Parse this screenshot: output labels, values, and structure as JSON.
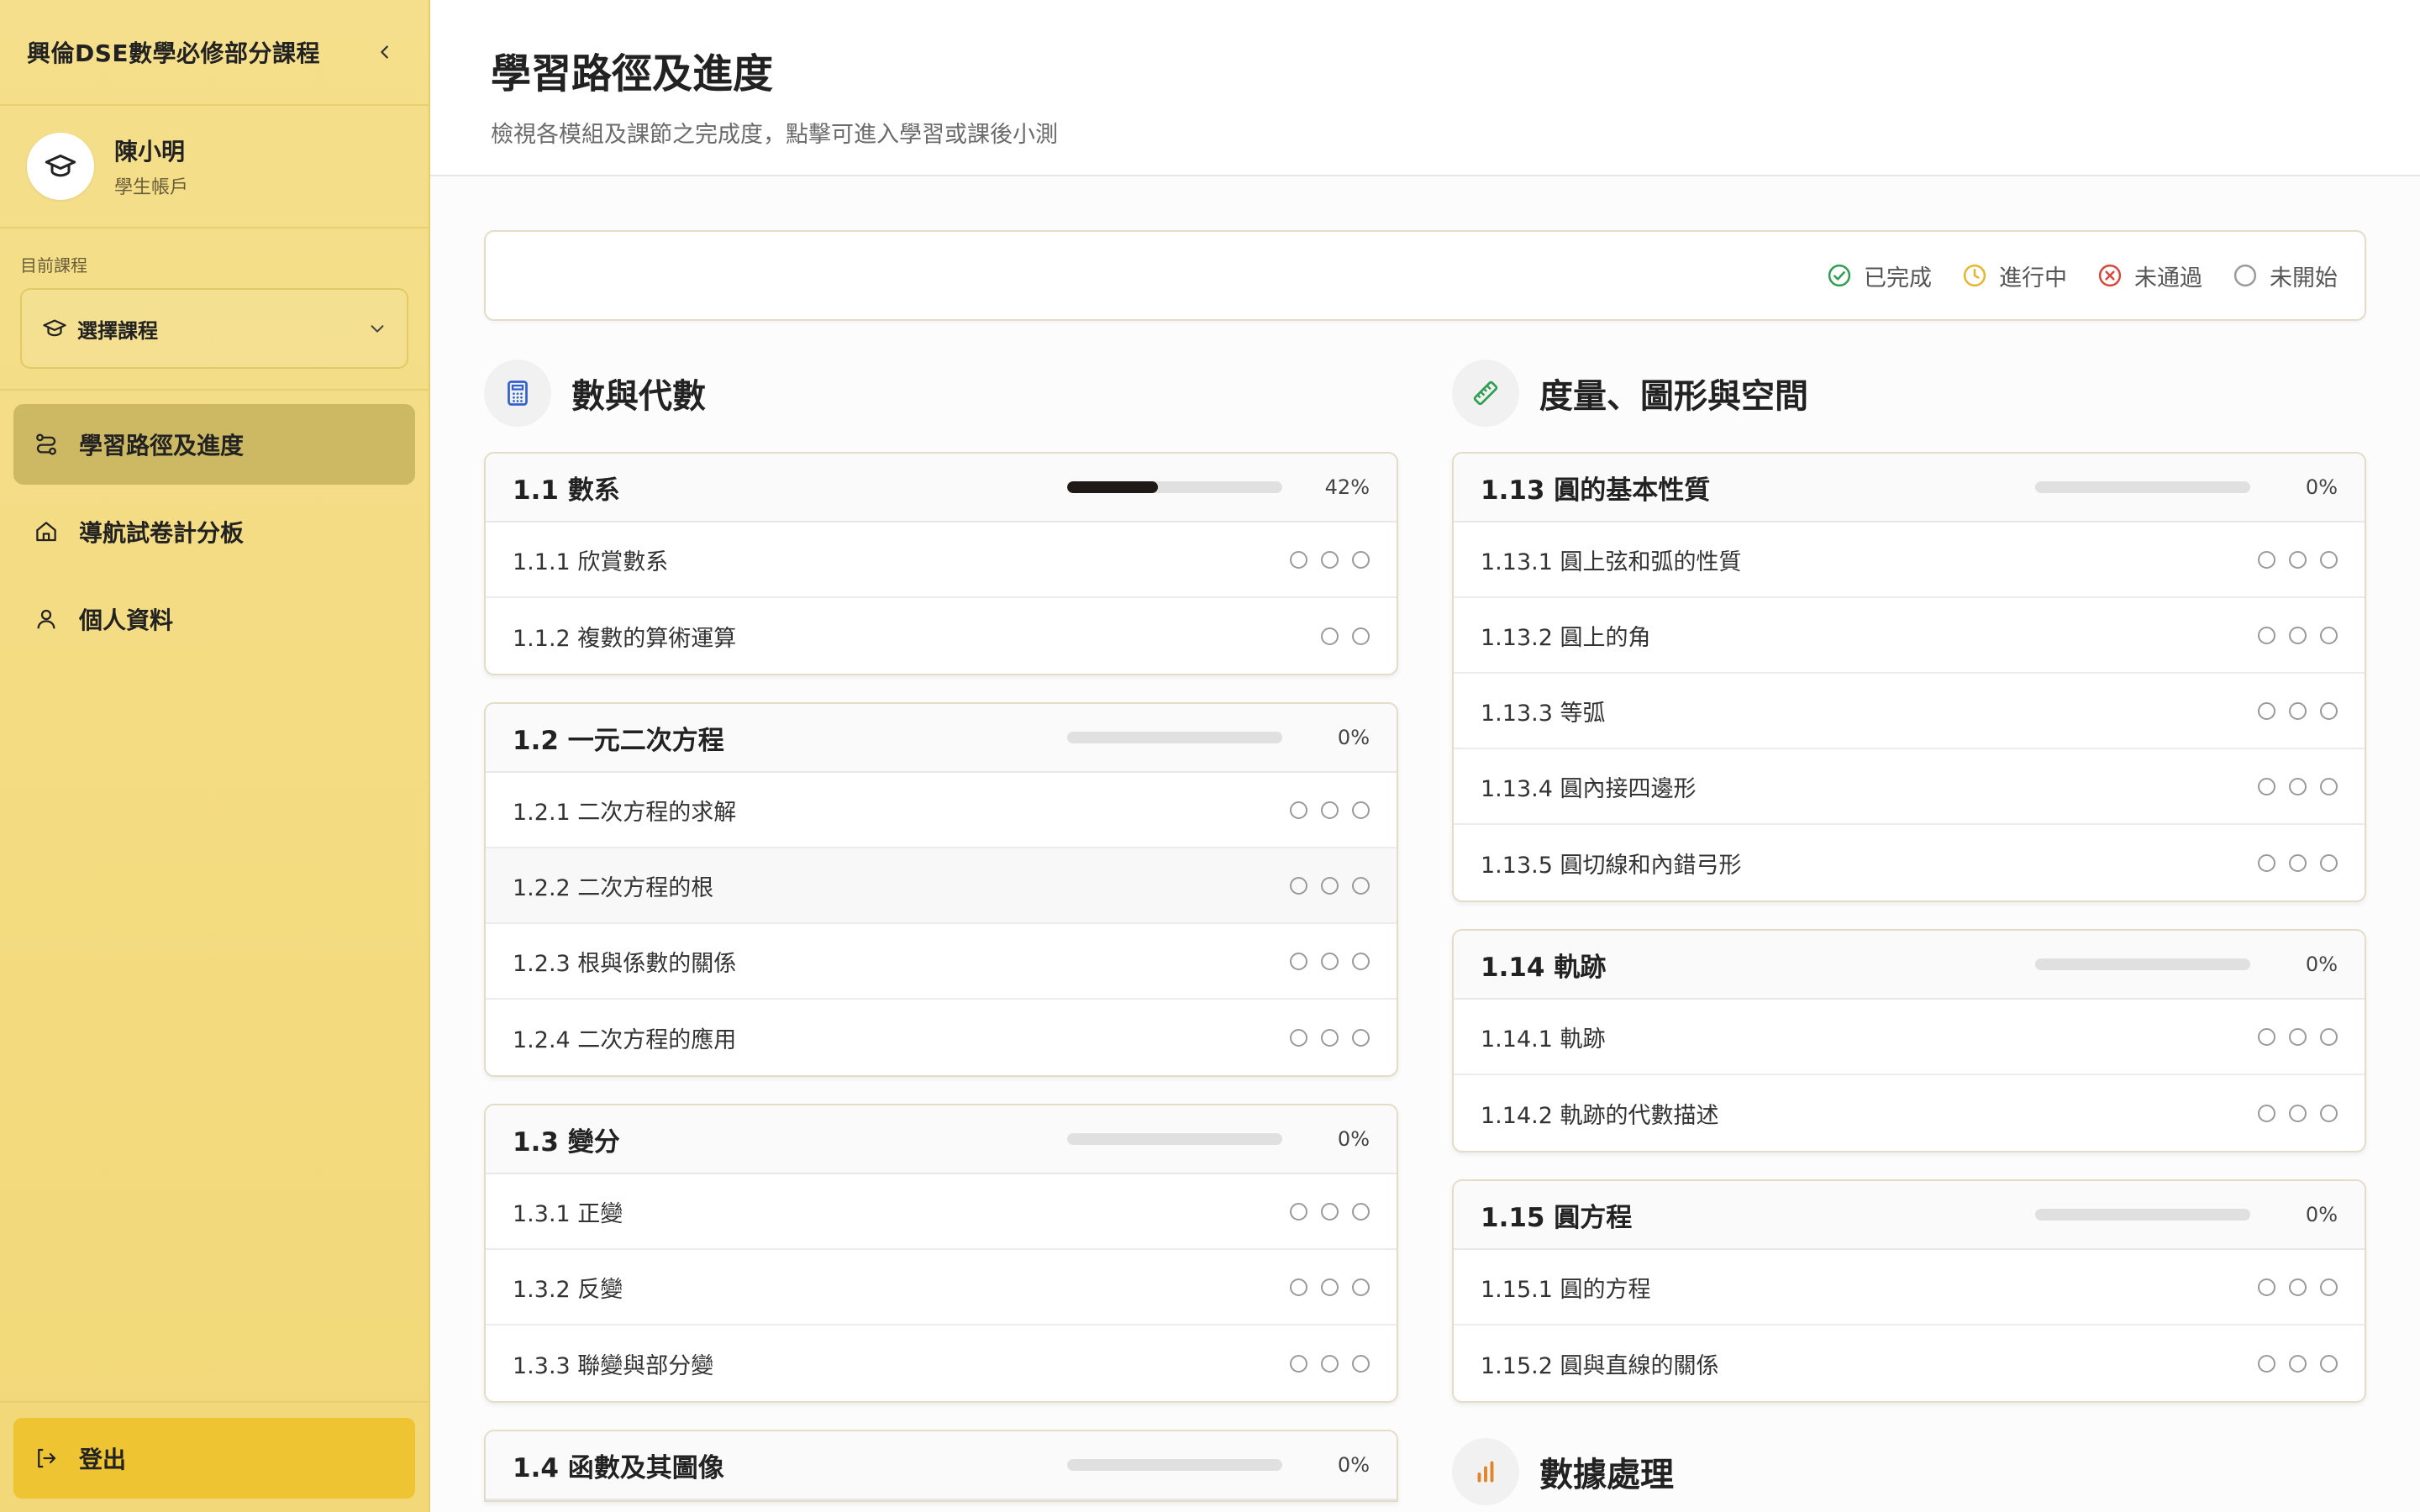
{
  "sidebar": {
    "title": "興倫DSE數學必修部分課程",
    "user": {
      "name": "陳小明",
      "role": "學生帳戶"
    },
    "course_label": "目前課程",
    "course_select": "選擇課程",
    "nav": [
      {
        "label": "學習路徑及進度",
        "icon": "path-icon",
        "active": true
      },
      {
        "label": "導航試卷計分板",
        "icon": "home-icon",
        "active": false
      },
      {
        "label": "個人資料",
        "icon": "user-icon",
        "active": false
      }
    ],
    "logout": "登出"
  },
  "header": {
    "title": "學習路徑及進度",
    "subtitle": "檢視各模組及課節之完成度，點擊可進入學習或課後小測"
  },
  "legend": [
    "已完成",
    "進行中",
    "未通過",
    "未開始"
  ],
  "colors": {
    "completed": "#2e9e4f",
    "in_progress": "#e8b52a",
    "failed": "#d9463b",
    "not_started": "#9a9a9a",
    "sidebar_bg": "#f5df8c",
    "nav_active": "#cdb863",
    "logout_bg": "#efc433"
  },
  "left": {
    "section_title": "數與代數",
    "section_icon": "calculator-icon",
    "modules": [
      {
        "title": "1.1 數系",
        "progress": 0.42,
        "pct": "42%",
        "lessons": [
          {
            "label": "1.1.1 欣賞數系",
            "dots": 3
          },
          {
            "label": "1.1.2 複數的算術運算",
            "dots": 2
          }
        ]
      },
      {
        "title": "1.2 一元二次方程",
        "progress": 0,
        "pct": "0%",
        "lessons": [
          {
            "label": "1.2.1 二次方程的求解",
            "dots": 3
          },
          {
            "label": "1.2.2 二次方程的根",
            "dots": 3
          },
          {
            "label": "1.2.3 根與係數的關係",
            "dots": 3
          },
          {
            "label": "1.2.4 二次方程的應用",
            "dots": 3
          }
        ]
      },
      {
        "title": "1.3 變分",
        "progress": 0,
        "pct": "0%",
        "lessons": [
          {
            "label": "1.3.1 正變",
            "dots": 3
          },
          {
            "label": "1.3.2 反變",
            "dots": 3
          },
          {
            "label": "1.3.3 聯變與部分變",
            "dots": 3
          }
        ]
      },
      {
        "title": "1.4 函數及其圖像",
        "progress": 0,
        "pct": "0%",
        "lessons": []
      }
    ]
  },
  "right": {
    "section_title": "度量、圖形與空間",
    "section_icon": "ruler-icon",
    "modules": [
      {
        "title": "1.13 圓的基本性質",
        "progress": 0,
        "pct": "0%",
        "lessons": [
          {
            "label": "1.13.1 圓上弦和弧的性質",
            "dots": 3
          },
          {
            "label": "1.13.2 圓上的角",
            "dots": 3
          },
          {
            "label": "1.13.3 等弧",
            "dots": 3
          },
          {
            "label": "1.13.4 圓內接四邊形",
            "dots": 3
          },
          {
            "label": "1.13.5 圓切線和內錯弓形",
            "dots": 3
          }
        ]
      },
      {
        "title": "1.14 軌跡",
        "progress": 0,
        "pct": "0%",
        "lessons": [
          {
            "label": "1.14.1 軌跡",
            "dots": 3
          },
          {
            "label": "1.14.2 軌跡的代數描述",
            "dots": 3
          }
        ]
      },
      {
        "title": "1.15 圓方程",
        "progress": 0,
        "pct": "0%",
        "lessons": [
          {
            "label": "1.15.1 圓的方程",
            "dots": 3
          },
          {
            "label": "1.15.2 圓與直線的關係",
            "dots": 3
          }
        ]
      }
    ],
    "section2_title": "數據處理",
    "section2_icon": "bar-chart-icon"
  }
}
